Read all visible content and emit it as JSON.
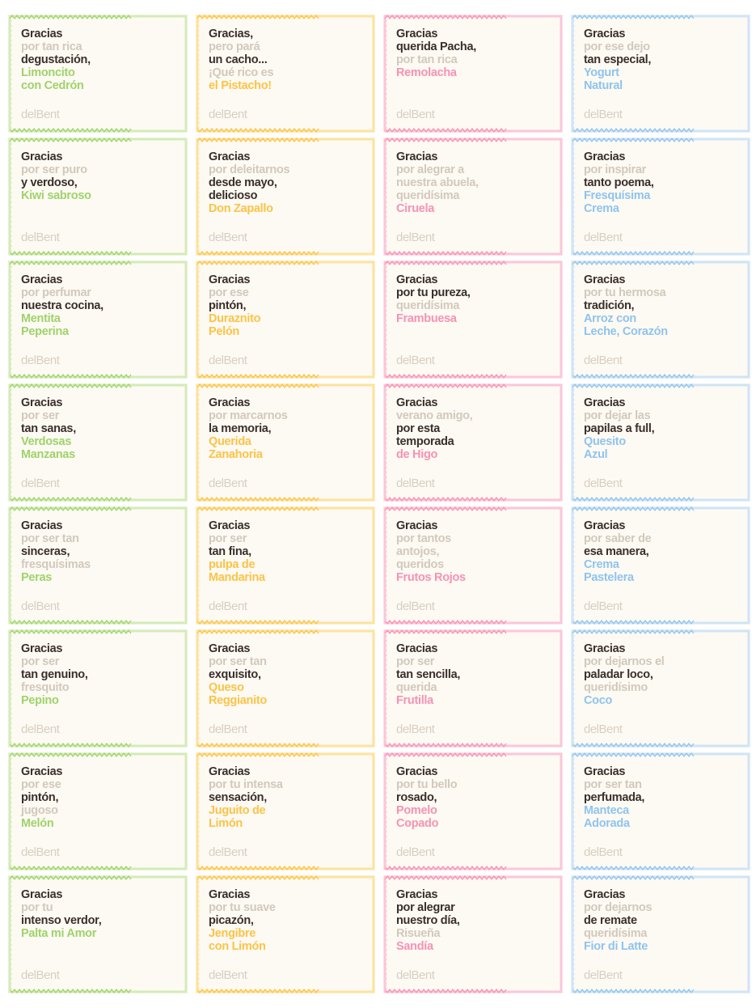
{
  "brand": "delBent",
  "colors": {
    "green": "#9fd36a",
    "greenLight": "#d4ecb7",
    "greenDark": "#6fb544",
    "yellow": "#fcc346",
    "yellowLight": "#fde39e",
    "yellowDark": "#f6a41c",
    "pink": "#f792b5",
    "pinkLight": "#fbc7d9",
    "pinkDark": "#e96d99",
    "blue": "#8fc4ee",
    "blueLight": "#cfe4f7",
    "blueDark": "#5ca5dd",
    "dark": "#3a2f2a",
    "gray": "#d2c9bd",
    "logo": "#d8cfc3",
    "beige": "#ece5d6",
    "beigeDark": "#cfc4b0",
    "brown": "#4b3a30"
  },
  "columns": [
    {
      "theme": "green",
      "cards": [
        {
          "lines": [
            [
              "Gracias",
              "d"
            ],
            [
              "por tan rica",
              "g"
            ],
            [
              "degustación,",
              "d"
            ],
            [
              "Limoncito",
              "c"
            ],
            [
              "con Cedrón",
              "c"
            ]
          ],
          "pattern": "citrus"
        },
        {
          "lines": [
            [
              "Gracias",
              "d"
            ],
            [
              "por ser puro",
              "g"
            ],
            [
              "y verdoso,",
              "d"
            ],
            [
              "Kiwi sabroso",
              "c"
            ]
          ],
          "pattern": "kiwi"
        },
        {
          "lines": [
            [
              "Gracias",
              "d"
            ],
            [
              "por perfumar",
              "g"
            ],
            [
              "nuestra cocina,",
              "d"
            ],
            [
              "Mentita",
              "c"
            ],
            [
              "Peperina",
              "c"
            ]
          ],
          "pattern": "leafwave"
        },
        {
          "lines": [
            [
              "Gracias",
              "d"
            ],
            [
              "por ser",
              "g"
            ],
            [
              "tan sanas,",
              "d"
            ],
            [
              "Verdosas",
              "c"
            ],
            [
              "Manzanas",
              "c"
            ]
          ],
          "pattern": "apple"
        },
        {
          "lines": [
            [
              "Gracias",
              "d"
            ],
            [
              "por ser tan",
              "g"
            ],
            [
              "sinceras,",
              "d"
            ],
            [
              "fresquísimas",
              "g"
            ],
            [
              "Peras",
              "c"
            ]
          ],
          "pattern": "pear"
        },
        {
          "lines": [
            [
              "Gracias",
              "d"
            ],
            [
              "por ser",
              "g"
            ],
            [
              "tan genuino,",
              "d"
            ],
            [
              "fresquito",
              "g"
            ],
            [
              "Pepino",
              "c"
            ]
          ],
          "pattern": "cucumber"
        },
        {
          "lines": [
            [
              "Gracias",
              "d"
            ],
            [
              "por ese",
              "g"
            ],
            [
              "pintón,",
              "d"
            ],
            [
              "jugoso",
              "g"
            ],
            [
              "Melón",
              "c"
            ]
          ],
          "pattern": "melon"
        },
        {
          "lines": [
            [
              "Gracias",
              "d"
            ],
            [
              "por tu",
              "g"
            ],
            [
              "intenso verdor,",
              "d"
            ],
            [
              "Palta mi Amor",
              "c"
            ]
          ],
          "pattern": "avocado"
        }
      ]
    },
    {
      "theme": "yellow",
      "cards": [
        {
          "lines": [
            [
              "Gracias,",
              "d"
            ],
            [
              "pero pará",
              "g"
            ],
            [
              "un cacho...",
              "d"
            ],
            [
              "¡Qué rico es",
              "g"
            ],
            [
              "el Pistacho!",
              "c"
            ]
          ],
          "pattern": "chevron"
        },
        {
          "lines": [
            [
              "Gracias",
              "d"
            ],
            [
              "por deleitarnos",
              "g"
            ],
            [
              "desde mayo,",
              "d"
            ],
            [
              "delicioso",
              "d"
            ],
            [
              "Don Zapallo",
              "c"
            ]
          ],
          "pattern": "flower"
        },
        {
          "lines": [
            [
              "Gracias",
              "d"
            ],
            [
              "por ese",
              "g"
            ],
            [
              "pintón,",
              "d"
            ],
            [
              "Duraznito",
              "c"
            ],
            [
              "Pelón",
              "c"
            ]
          ],
          "pattern": "peach"
        },
        {
          "lines": [
            [
              "Gracias",
              "d"
            ],
            [
              "por marcarnos",
              "g"
            ],
            [
              "la memoria,",
              "d"
            ],
            [
              "Querida",
              "c"
            ],
            [
              "Zanahoria",
              "c"
            ]
          ],
          "pattern": "carrot"
        },
        {
          "lines": [
            [
              "Gracias",
              "d"
            ],
            [
              "por ser",
              "g"
            ],
            [
              "tan fina,",
              "d"
            ],
            [
              "pulpa de",
              "c"
            ],
            [
              "Mandarina",
              "c"
            ]
          ],
          "pattern": "citrusbig"
        },
        {
          "lines": [
            [
              "Gracias",
              "d"
            ],
            [
              "por ser tan",
              "g"
            ],
            [
              "exquisito,",
              "d"
            ],
            [
              "Queso",
              "c"
            ],
            [
              "Reggianito",
              "c"
            ]
          ],
          "pattern": "cheese"
        },
        {
          "lines": [
            [
              "Gracias",
              "d"
            ],
            [
              "por tu intensa",
              "g"
            ],
            [
              "sensación,",
              "d"
            ],
            [
              "Juguito de",
              "c"
            ],
            [
              "Limón",
              "c"
            ]
          ],
          "pattern": "citrus"
        },
        {
          "lines": [
            [
              "Gracias",
              "d"
            ],
            [
              "por tu suave",
              "g"
            ],
            [
              "picazón,",
              "d"
            ],
            [
              "Jengibre",
              "c"
            ],
            [
              "con Limón",
              "c"
            ]
          ],
          "pattern": "citrus"
        }
      ]
    },
    {
      "theme": "pink",
      "cards": [
        {
          "lines": [
            [
              "Gracias",
              "d"
            ],
            [
              "querida Pacha,",
              "d"
            ],
            [
              "por tan rica",
              "g"
            ],
            [
              "Remolacha",
              "c"
            ]
          ],
          "pattern": "beet"
        },
        {
          "lines": [
            [
              "Gracias",
              "d"
            ],
            [
              "por alegrar a",
              "g"
            ],
            [
              "nuestra abuela,",
              "g"
            ],
            [
              "queridísima",
              "g"
            ],
            [
              "Ciruela",
              "c"
            ]
          ],
          "pattern": "plum"
        },
        {
          "lines": [
            [
              "Gracias",
              "d"
            ],
            [
              "por tu pureza,",
              "dg"
            ],
            [
              "queridísima",
              "g"
            ],
            [
              "Frambuesa",
              "c"
            ]
          ],
          "pattern": "raspberry"
        },
        {
          "lines": [
            [
              "Gracias",
              "d"
            ],
            [
              "verano amigo,",
              "g"
            ],
            [
              "por esta",
              "d"
            ],
            [
              "temporada",
              "d"
            ],
            [
              "de Higo",
              "c"
            ]
          ],
          "pattern": "fig"
        },
        {
          "lines": [
            [
              "Gracias",
              "d"
            ],
            [
              "por tantos",
              "g"
            ],
            [
              "antojos,",
              "g"
            ],
            [
              "queridos",
              "g"
            ],
            [
              "Frutos Rojos",
              "c"
            ]
          ],
          "pattern": "berries"
        },
        {
          "lines": [
            [
              "Gracias",
              "d"
            ],
            [
              "por ser",
              "g"
            ],
            [
              "tan sencilla,",
              "gd"
            ],
            [
              "querida",
              "g"
            ],
            [
              "Frutilla",
              "c"
            ]
          ],
          "pattern": "strawberry"
        },
        {
          "lines": [
            [
              "Gracias",
              "d"
            ],
            [
              "por tu bello",
              "g"
            ],
            [
              "rosado,",
              "d"
            ],
            [
              "Pomelo",
              "c"
            ],
            [
              "Copado",
              "c"
            ]
          ],
          "pattern": "citrus"
        },
        {
          "lines": [
            [
              "Gracias",
              "d"
            ],
            [
              "por alegrar",
              "dg"
            ],
            [
              "nuestro día,",
              "d"
            ],
            [
              "Risueña",
              "g"
            ],
            [
              "Sandía",
              "c"
            ]
          ],
          "pattern": "watermelon"
        }
      ]
    },
    {
      "theme": "blue",
      "cards": [
        {
          "lines": [
            [
              "Gracias",
              "d"
            ],
            [
              "por ese dejo",
              "g"
            ],
            [
              "tan especial,",
              "d"
            ],
            [
              "Yogurt",
              "c"
            ],
            [
              "Natural",
              "c"
            ]
          ],
          "pattern": "diamond"
        },
        {
          "lines": [
            [
              "Gracias",
              "d"
            ],
            [
              "por inspirar",
              "g"
            ],
            [
              "tanto poema,",
              "d"
            ],
            [
              "Fresquísima",
              "c"
            ],
            [
              "Crema",
              "c"
            ]
          ],
          "pattern": "diamond"
        },
        {
          "lines": [
            [
              "Gracias",
              "d"
            ],
            [
              "por tu hermosa",
              "g"
            ],
            [
              "tradición,",
              "d"
            ],
            [
              "Arroz con",
              "c"
            ],
            [
              "Leche, Corazón",
              "c"
            ]
          ],
          "pattern": "leafcross"
        },
        {
          "lines": [
            [
              "Gracias",
              "d"
            ],
            [
              "por dejar las",
              "g"
            ],
            [
              "papilas a full,",
              "d"
            ],
            [
              "Quesito",
              "c"
            ],
            [
              "Azul",
              "c"
            ]
          ],
          "pattern": "cheese"
        },
        {
          "lines": [
            [
              "Gracias",
              "d"
            ],
            [
              "por saber de",
              "g"
            ],
            [
              "esa manera,",
              "d"
            ],
            [
              "Crema",
              "c"
            ],
            [
              "Pastelera",
              "c"
            ]
          ],
          "pattern": "swirl"
        },
        {
          "lines": [
            [
              "Gracias",
              "d"
            ],
            [
              "por dejarnos el",
              "g"
            ],
            [
              "paladar loco,",
              "d"
            ],
            [
              "queridísimo",
              "g"
            ],
            [
              "Coco",
              "c"
            ]
          ],
          "pattern": "coco"
        },
        {
          "lines": [
            [
              "Gracias",
              "d"
            ],
            [
              "por ser tan",
              "g"
            ],
            [
              "perfumada,",
              "d"
            ],
            [
              "Manteca",
              "c"
            ],
            [
              "Adorada",
              "c"
            ]
          ],
          "pattern": "diamond"
        },
        {
          "lines": [
            [
              "Gracias",
              "d"
            ],
            [
              "por dejarnos",
              "g"
            ],
            [
              "de remate",
              "d"
            ],
            [
              "queridísima",
              "g"
            ],
            [
              "Fior di Latte",
              "c"
            ]
          ],
          "pattern": "wave"
        }
      ]
    }
  ]
}
